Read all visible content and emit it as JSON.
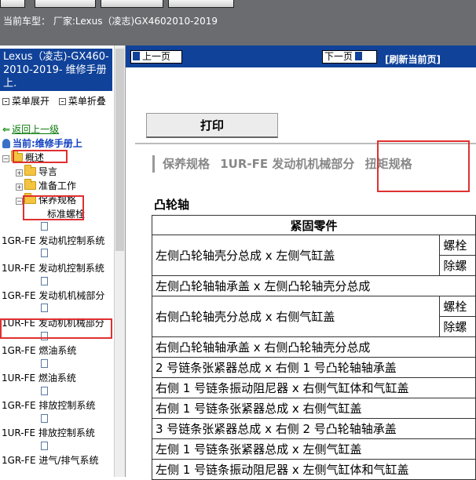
{
  "header": {
    "vehicle_label": "当前车型：",
    "vehicle_value": "厂家:Lexus（凌志)GX4602010-2019"
  },
  "sidebar": {
    "manual_title": "Lexus（凌志)-GX460-2010-2019- 维修手册上.",
    "expand_label": "菜单展开",
    "collapse_label": "菜单折叠",
    "back_label": "返回上一级",
    "current_label": "当前:维修手册上",
    "tree": {
      "overview": "概述",
      "intro": "导言",
      "prep": "准备工作",
      "maint_spec": "保养规格",
      "std_bolt": "标准螺栓",
      "s1": "1GR-FE 发动机控制系统",
      "s2": "1UR-FE 发动机控制系统",
      "s3": "1GR-FE 发动机机械部分",
      "s4": "1UR-FE 发动机机械部分",
      "s5": "1GR-FE 燃油系统",
      "s6": "1UR-FE 燃油系统",
      "s7": "1GR-FE 排放控制系统",
      "s8": "1UR-FE 排放控制系统",
      "s9": "1GR-FE 进气/排气系统"
    }
  },
  "toolbar": {
    "prev_label": "上一页",
    "next_label": "下一页",
    "refresh_label": "[刷新当前页]",
    "print_label": "打印"
  },
  "breadcrumb": {
    "level1": "保养规格",
    "level2": "1UR-FE 发动机机械部分",
    "level3": "扭矩规格"
  },
  "section": {
    "title": "凸轮轴",
    "header": "紧固零件",
    "rows": [
      {
        "part": "左侧凸轮轴壳分总成 x 左侧气缸盖",
        "sub1": "螺栓",
        "sub2": "除螺"
      },
      {
        "part": "左侧凸轮轴轴承盖 x 左侧凸轮轴壳分总成"
      },
      {
        "part": "右侧凸轮轴壳分总成 x 右侧气缸盖",
        "sub1": "螺栓",
        "sub2": "除螺"
      },
      {
        "part": "右侧凸轮轴轴承盖 x 右侧凸轮轴壳分总成"
      },
      {
        "part": "2 号链条张紧器总成 x 右侧 1 号凸轮轴轴承盖"
      },
      {
        "part": "右侧 1 号链条振动阻尼器 x 右侧气缸体和气缸盖"
      },
      {
        "part": "右侧 1 号链条张紧器总成 x 右侧气缸盖"
      },
      {
        "part": "3 号链条张紧器总成 x 右侧 2 号凸轮轴轴承盖"
      },
      {
        "part": "左侧 1 号链条张紧器总成 x 左侧气缸盖"
      },
      {
        "part": "左侧 1 号链条振动阻尼器 x 左侧气缸体和气缸盖"
      }
    ]
  },
  "colors": {
    "nav_blue": "#10429a",
    "highlight_red": "#e03030",
    "header_gray": "#6a6c70"
  }
}
